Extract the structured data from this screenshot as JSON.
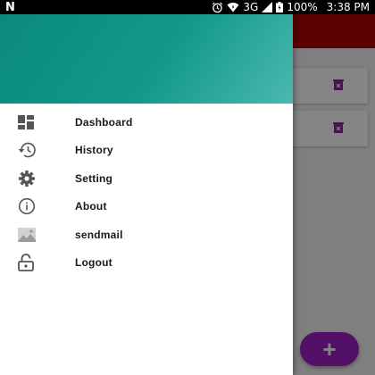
{
  "status_bar": {
    "network": "3G",
    "battery": "100%",
    "time": "3:38 PM"
  },
  "drawer": {
    "menu": [
      {
        "label": "Dashboard",
        "icon": "dashboard-icon"
      },
      {
        "label": "History",
        "icon": "history-icon"
      },
      {
        "label": "Setting",
        "icon": "gear-icon"
      },
      {
        "label": "About",
        "icon": "info-icon"
      },
      {
        "label": "sendmail",
        "icon": "image-icon"
      },
      {
        "label": "Logout",
        "icon": "lock-icon"
      }
    ]
  },
  "fab": {
    "label": "+"
  },
  "colors": {
    "toolbar": "#b00000",
    "drawer_header": "#0a8a7a",
    "fab": "#a020c8",
    "delete_icon": "#8e1f9a"
  }
}
